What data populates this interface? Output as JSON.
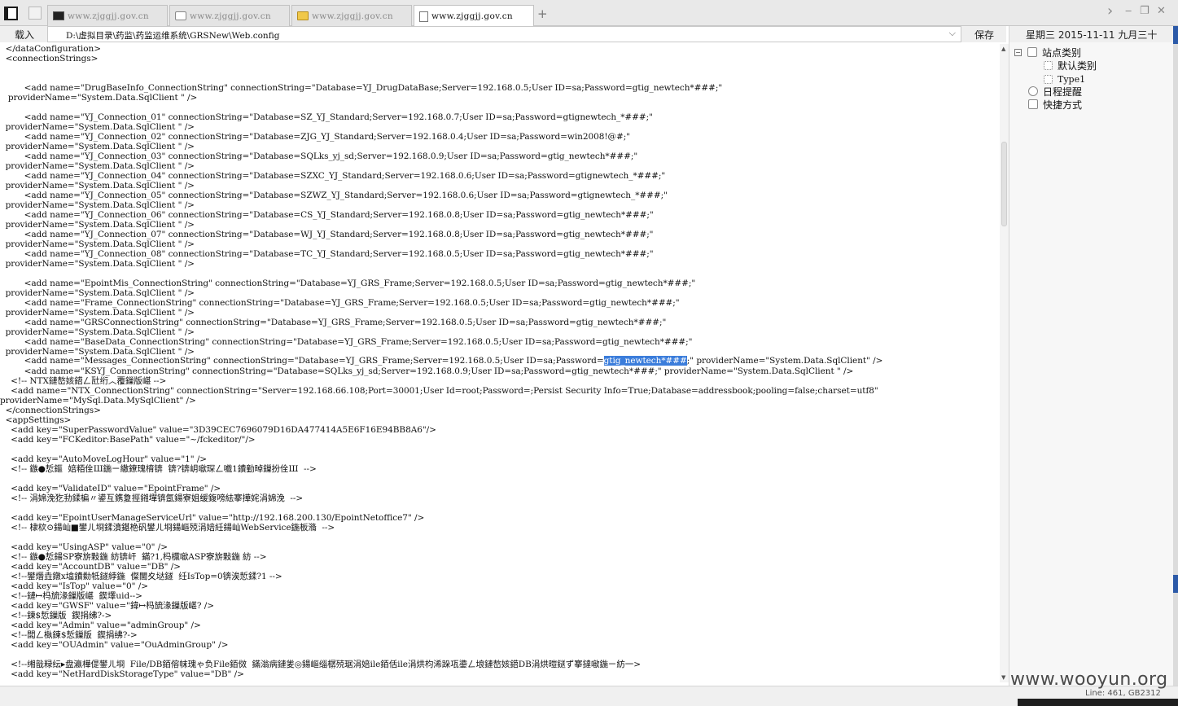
{
  "tabs": [
    {
      "label": "www.zjggjj.gov.cn",
      "icon": "terminal-icon"
    },
    {
      "label": "www.zjggjj.gov.cn",
      "icon": "page-icon"
    },
    {
      "label": "www.zjggjj.gov.cn",
      "icon": "folder-icon"
    },
    {
      "label": "www.zjggjj.gov.cn",
      "icon": "document-icon"
    }
  ],
  "new_tab_glyph": "+",
  "window_controls": {
    "forward": "›",
    "minimize": "‒",
    "restore": "❐",
    "close": "✕"
  },
  "toolbar": {
    "load_label": "载入",
    "path_value": "D:\\虚拟目录\\药监\\药监运维系统\\GRSNew\\Web.config",
    "save_label": "保存"
  },
  "right_panel": {
    "date": "星期三 2015-11-11 九月三十",
    "tree": {
      "root": "站点类别",
      "children": [
        "默认类别",
        "Type1"
      ],
      "schedule": "日程提醒",
      "shortcut": "快捷方式"
    }
  },
  "editor": {
    "lines": [
      "  </dataConfiguration>",
      "  <connectionStrings>",
      "",
      "",
      "         <add name=\"DrugBaseInfo_ConnectionString\" connectionString=\"Database=YJ_DrugDataBase;Server=192.168.0.5;User ID=sa;Password=gtig_newtech*###;\"",
      "   providerName=\"System.Data.SqlClient \" />",
      "",
      "         <add name=\"YJ_Connection_01\" connectionString=\"Database=SZ_YJ_Standard;Server=192.168.0.7;User ID=sa;Password=gtignewtech_*###;\"",
      "  providerName=\"System.Data.SqlClient \" />",
      "         <add name=\"YJ_Connection_02\" connectionString=\"Database=ZJG_YJ_Standard;Server=192.168.0.4;User ID=sa;Password=win2008!@#;\"",
      "  providerName=\"System.Data.SqlClient \" />",
      "         <add name=\"YJ_Connection_03\" connectionString=\"Database=SQLks_yj_sd;Server=192.168.0.9;User ID=sa;Password=gtig_newtech*###;\"",
      "  providerName=\"System.Data.SqlClient \" />",
      "         <add name=\"YJ_Connection_04\" connectionString=\"Database=SZXC_YJ_Standard;Server=192.168.0.6;User ID=sa;Password=gtignewtech_*###;\"",
      "  providerName=\"System.Data.SqlClient \" />",
      "         <add name=\"YJ_Connection_05\" connectionString=\"Database=SZWZ_YJ_Standard;Server=192.168.0.6;User ID=sa;Password=gtignewtech_*###;\"",
      "  providerName=\"System.Data.SqlClient \" />",
      "         <add name=\"YJ_Connection_06\" connectionString=\"Database=CS_YJ_Standard;Server=192.168.0.8;User ID=sa;Password=gtig_newtech*###;\"",
      "  providerName=\"System.Data.SqlClient \" />",
      "         <add name=\"YJ_Connection_07\" connectionString=\"Database=WJ_YJ_Standard;Server=192.168.0.8;User ID=sa;Password=gtig_newtech*###;\"",
      "  providerName=\"System.Data.SqlClient \" />",
      "         <add name=\"YJ_Connection_08\" connectionString=\"Database=TC_YJ_Standard;Server=192.168.0.5;User ID=sa;Password=gtig_newtech*###;\"",
      "  providerName=\"System.Data.SqlClient \" />",
      "",
      "         <add name=\"EpointMis_ConnectionString\" connectionString=\"Database=YJ_GRS_Frame;Server=192.168.0.5;User ID=sa;Password=gtig_newtech*###;\"",
      "  providerName=\"System.Data.SqlClient \" />",
      "         <add name=\"Frame_ConnectionString\" connectionString=\"Database=YJ_GRS_Frame;Server=192.168.0.5;User ID=sa;Password=gtig_newtech*###;\"",
      "  providerName=\"System.Data.SqlClient \" />",
      "         <add name=\"GRSConnectionString\" connectionString=\"Database=YJ_GRS_Frame;Server=192.168.0.5;User ID=sa;Password=gtig_newtech*###;\"",
      "  providerName=\"System.Data.SqlClient \" />",
      "         <add name=\"BaseData_ConnectionString\" connectionString=\"Database=YJ_GRS_Frame;Server=192.168.0.5;User ID=sa;Password=gtig_newtech*###;\"",
      "  providerName=\"System.Data.SqlClient \" />",
      "",
      "         <add name=\"KSYJ_ConnectionString\" connectionString=\"Database=SQLks_yj_sd;Server=192.168.0.9;User ID=sa;Password=gtig_newtech*###;\" providerName=\"System.Data.SqlClient \" />",
      "    <!-- NTX鏈嶅姟鍣ㄥ瓧绗︿覆鏁版嵁 -->",
      "    <add name=\"NTX_ConnectionString\" connectionString=\"Server=192.168.66.108;Port=30001;User Id=root;Password=;Persist Security Info=True;Database=addressbook;pooling=false;charset=utf8\"",
      "providerName=\"MySql.Data.MySqlClient\" />",
      "  </connectionStrings>",
      "  <appSettings>",
      "    <add key=\"SuperPasswordValue\" value=\"3D39CEC7696079D16DA477414A5E6F16E94BB8A6\"/>",
      "    <add key=\"FCKeditor:BasePath\" value=\"~/fckeditor/\"/>",
      "",
      "    <add key=\"AutoMoveLogHour\" value=\"1\" />",
      "    <!-- 鏃●悊鏂  婄粨佺Ш鍦ㄧ繖鐐瑰棛锛  锛?锛岄噷琛ㄥ嚱1鐨勭晫鏁扮佺Ш  -->",
      "",
      "    <add key=\"ValidateID\" value=\"EpointFrame\" />",
      "    <!-- 涓婂浼犵劧鍒楄〃鍙互鎸夐挳鎺墠锛氬鍚寮姐缓鍑嗙紶搴撶姹涓婂浼  -->",
      "",
      "    <add key=\"EpointUserManageServiceUrl\" value=\"http://192.168.200.130/EpointNetoffice7\" />",
      "    <!-- 棣栨⊙鍚屾■鐢ㄦ埛鍒濆鍖栬矾鐢ㄦ埛鍚嶇殑涓婄紝鍚屾WebService鍦板潃  -->",
      "",
      "    <add key=\"UsingASP\" value=\"0\" />",
      "    <!-- 鏃●悊鍚SP寮旂敤鍦 紡锛屽  鏋?1,杩欓噷ASP寮旂敤鍦 紡 -->",
      "    <add key=\"AccountDB\" value=\"DB\" />",
      "    <!--鐢熸垚鐓х墖鐨勬牴鐩綍鍦  儏閫夊垯鐩  纴IsTop=0锛涘悊鍒?1 -->",
      "    <add key=\"IsTop\" value=\"0\" />",
      "    <!--鏈↦杩旈湪鏁版嵁  鍥墿uid-->",
      "    <add key=\"GWSF\" value=\"鍏↦杩旈湪鏁版嵁? />",
      "    <!--鍊$悊鏁版  鍥捐绋?->",
      "    <add key=\"Admin\" value=\"adminGroup\" />",
      "    <!--闆ㄥ槸鍊$悊鏁版  鍥捐绋?->",
      "    <add key=\"OUAdmin\" value=\"OuAdminGroup\" />",
      "",
      "    <!--缃戠粶纭▸盘瀛樺偍鐢ㄦ埛  File/DB銆傛帓瑰ゃ负File銆傚  鏋滃病鏈夎◎鍚嶇缁樼殑琚涓婄ile銆佸ile涓烘枃浠跺瓨鍌ㄥ埌鏈嶅姟鍣DB涓烘暟鎹ず搴撻噷鍦ㄧ紡一>",
      "    <add key=\"NetHardDiskStorageType\" value=\"DB\" />"
    ],
    "messages_line": {
      "before": "         <add name=\"Messages_ConnectionString\" connectionString=\"Database=YJ_GRS_Frame;Server=192.168.0.5;User ID=sa;Password=",
      "selected": "gtig_newtech*###",
      "after": ";\" providerName=\"System.Data.SqlClient\" />"
    }
  },
  "status": {
    "position": "Line: 461, GB2312"
  },
  "watermark": "www.wooyun.org",
  "colors": {
    "selection": "#3b7ddb",
    "accent_blue": "#2c5aa8"
  }
}
